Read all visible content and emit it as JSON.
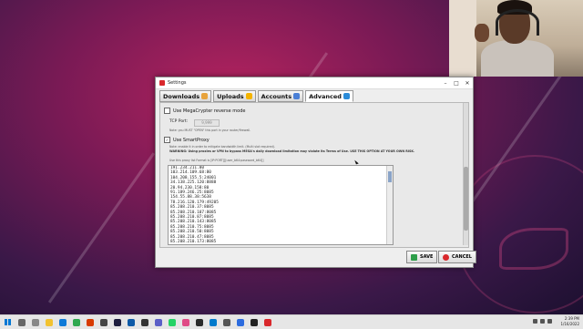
{
  "window": {
    "title": "Settings"
  },
  "tabs": [
    {
      "label": "Downloads",
      "icon": "download-icon",
      "color": "#e8a33c"
    },
    {
      "label": "Uploads",
      "icon": "upload-icon",
      "color": "#f4b400"
    },
    {
      "label": "Accounts",
      "icon": "accounts-icon",
      "color": "#4a7fd6"
    },
    {
      "label": "Advanced",
      "icon": "gear-icon",
      "color": "#2a8bd8"
    }
  ],
  "advanced": {
    "megacrypter_label": "Use MegaCrypter reverse mode",
    "tcp_port_label": "TCP Port:",
    "tcp_port_value": "9,999",
    "tcp_note": "Note: you MUST \"OPEN\" this port in your router/firewall.",
    "smartproxy_label": "Use SmartProxy",
    "smartproxy_note": "Note: enable it in order to mitigate bandwidth limit. (Multi slot required).",
    "warning": "WARNING: Using proxies or VPN to bypass MEGA's daily download limitation may violate its Terms of Use. USE THIS OPTION AT YOUR OWN RISK.",
    "format_note": "Use this proxy list Format is [IP:PORT][[user_b64:password_b64]]",
    "proxies": [
      "191.234.211.80",
      "103.214.109.68:80",
      "104.208.155.5:24001",
      "34.138.225.120:8888",
      "20.94.230.158:80",
      "91.189.246.25:8085",
      "154.55.88.38:5638",
      "78.216.120.179:49205",
      "85.208.210.37:8085",
      "85.208.210.107:8085",
      "85.208.210.87:8085",
      "85.208.210.143:8085",
      "85.208.210.75:8085",
      "85.208.210.50:8085",
      "85.208.210.47:8085",
      "85.208.210.173:8085",
      "85.208.210.171:8085"
    ]
  },
  "buttons": {
    "save": "SAVE",
    "cancel": "CANCEL"
  },
  "taskbar": {
    "time": "2:39 PM",
    "date": "1/16/2022"
  },
  "colors": {
    "accent_red": "#d9282c",
    "save_green": "#2e9e4a"
  }
}
